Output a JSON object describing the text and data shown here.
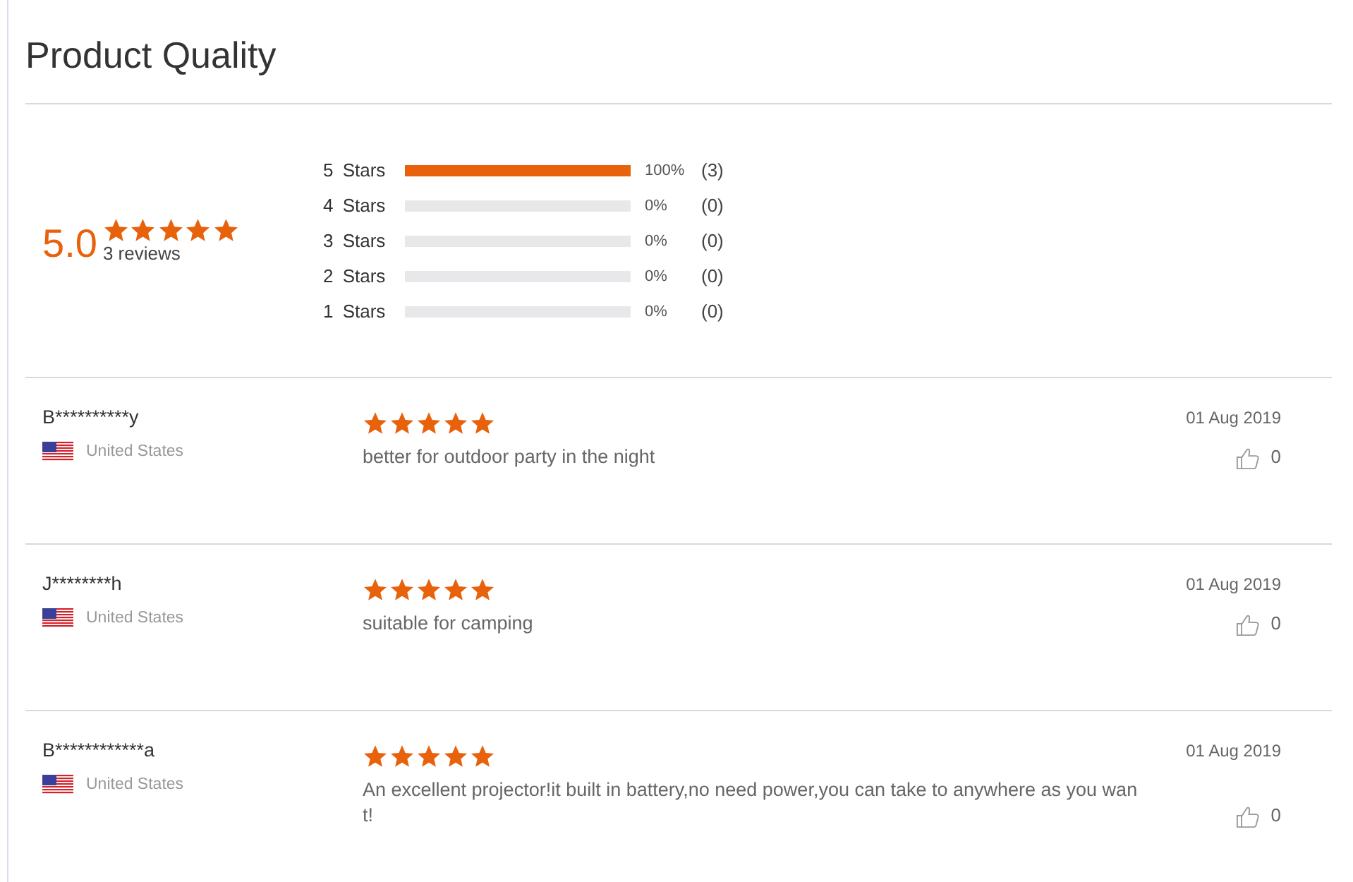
{
  "title": "Product Quality",
  "summary": {
    "score": "5.0",
    "stars": 5,
    "review_count": "3 reviews"
  },
  "histogram": [
    {
      "label": "5 Stars",
      "level": 1,
      "percent": "100%",
      "count": "(3)"
    },
    {
      "label": "4 Stars",
      "level": 0,
      "percent": "0%",
      "count": "(0)"
    },
    {
      "label": "3 Stars",
      "level": 0,
      "percent": "0%",
      "count": "(0)"
    },
    {
      "label": "2 Stars",
      "level": 0,
      "percent": "0%",
      "count": "(0)"
    },
    {
      "label": "1 Stars",
      "level": 0,
      "percent": "0%",
      "count": "(0)"
    }
  ],
  "reviews": [
    {
      "name": "B**********y",
      "country": "United States",
      "stars": 5,
      "text": "better for outdoor party in the night",
      "date": "01 Aug 2019",
      "likes": "0"
    },
    {
      "name": "J********h",
      "country": "United States",
      "stars": 5,
      "text": "suitable for camping",
      "date": "01 Aug 2019",
      "likes": "0"
    },
    {
      "name": "B************a",
      "country": "United States",
      "stars": 5,
      "text": "An excellent projector!it built in battery,no need power,you can take to anywhere as you want!",
      "date": "01 Aug 2019",
      "likes": "0"
    }
  ]
}
